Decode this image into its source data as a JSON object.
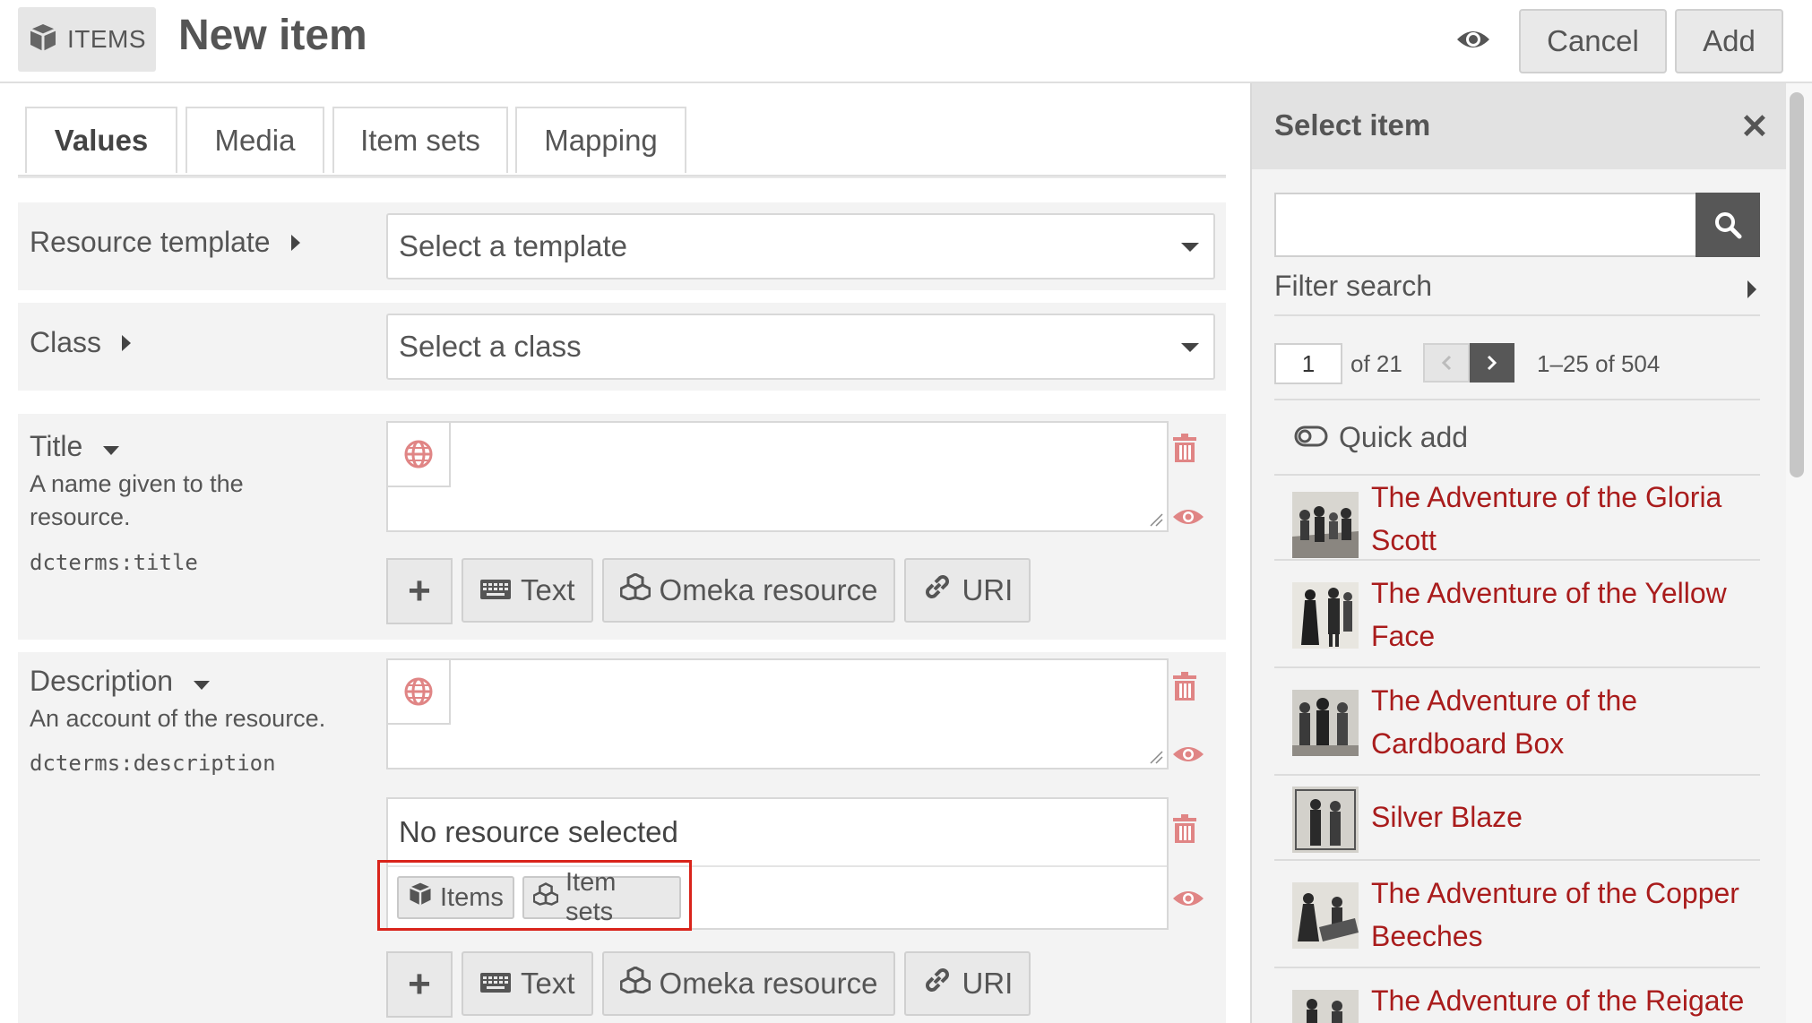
{
  "header": {
    "items_badge": "ITEMS",
    "title": "New item",
    "cancel_label": "Cancel",
    "add_label": "Add"
  },
  "tabs": [
    {
      "label": "Values",
      "active": true
    },
    {
      "label": "Media"
    },
    {
      "label": "Item sets"
    },
    {
      "label": "Mapping"
    }
  ],
  "form": {
    "resource_template": {
      "label": "Resource template",
      "value": "Select a template"
    },
    "class": {
      "label": "Class",
      "value": "Select a class"
    },
    "title_prop": {
      "label": "Title",
      "description": "A name given to the resource.",
      "term": "dcterms:title"
    },
    "description_prop": {
      "label": "Description",
      "description": "An account of the resource.",
      "term": "dcterms:description",
      "resource_value": "No resource selected",
      "resource_buttons": [
        "Items",
        "Item sets"
      ]
    },
    "add_value_buttons": {
      "plus": "+",
      "text": "Text",
      "omeka_resource": "Omeka resource",
      "uri": "URI"
    }
  },
  "sidebar": {
    "title": "Select item",
    "filter_label": "Filter search",
    "page": "1",
    "of_pages": "of 21",
    "range": "1–25 of 504",
    "quick_add": "Quick add",
    "items": [
      "The Adventure of the Gloria Scott",
      "The Adventure of the Yellow Face",
      "The Adventure of the Cardboard Box",
      "Silver Blaze",
      "The Adventure of the Copper Beeches",
      "The Adventure of the Reigate Squires"
    ]
  },
  "colors": {
    "link_red": "#a91c1c",
    "highlight_frame": "#d9241b",
    "icon_pink": "#e08585",
    "button_gray": "#e9e9e9",
    "dark_button": "#575757"
  }
}
